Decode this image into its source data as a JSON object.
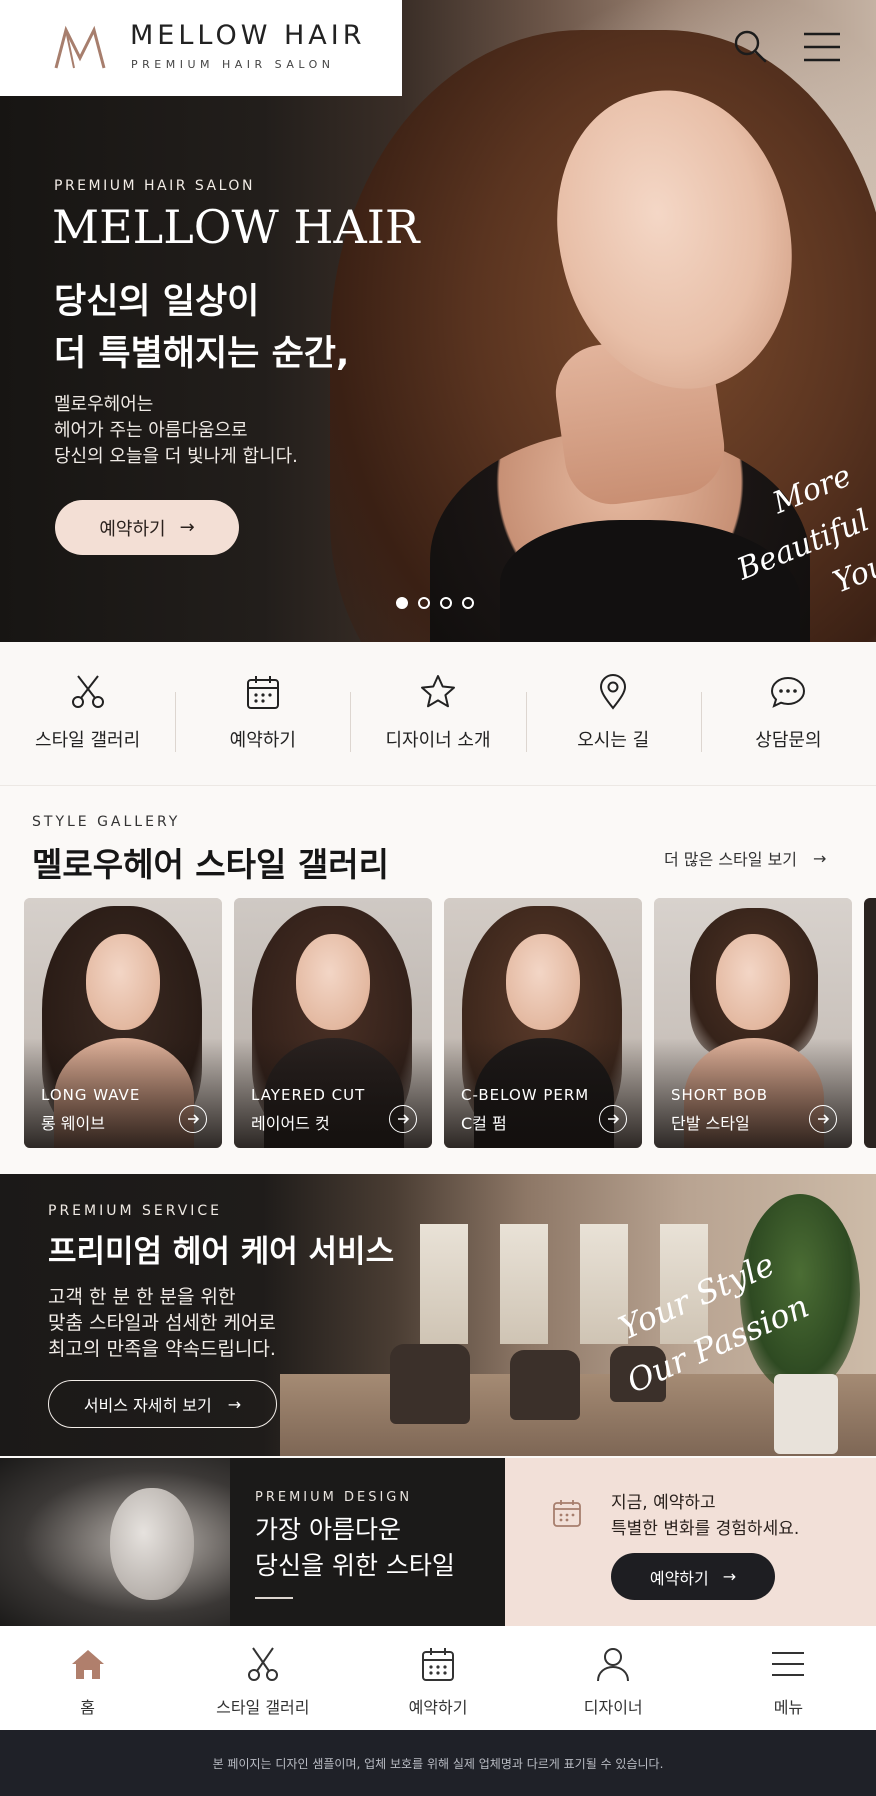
{
  "header": {
    "logo_title": "MELLOW HAIR",
    "logo_subtitle": "PREMIUM HAIR SALON",
    "logo_mark_icon": "mellow-hair-logo-icon",
    "search_icon": "search-icon",
    "menu_icon": "hamburger-menu-icon"
  },
  "hero": {
    "eyebrow": "PREMIUM HAIR SALON",
    "brand": "MELLOW HAIR",
    "headline": "당신의 일상이\n더 특별해지는 순간,",
    "description": "멜로우헤어는\n헤어가 주는 아름다움으로\n당신의 오늘을 더 빛나게 합니다.",
    "button_label": "예약하기",
    "button_arrow": "→",
    "script_text": "More Beautiful\nYou",
    "slides_total": 4,
    "active_slide": 1
  },
  "quick_menu": [
    {
      "label": "스타일 갤러리",
      "icon": "scissors-icon"
    },
    {
      "label": "예약하기",
      "icon": "calendar-icon"
    },
    {
      "label": "디자이너 소개",
      "icon": "star-icon"
    },
    {
      "label": "오시는 길",
      "icon": "map-pin-icon"
    },
    {
      "label": "상담문의",
      "icon": "chat-bubble-icon"
    }
  ],
  "gallery": {
    "eyebrow": "STYLE GALLERY",
    "title": "멜로우헤어 스타일 갤러리",
    "more_label": "더 많은 스타일 보기",
    "more_arrow": "→",
    "cards": [
      {
        "en": "LONG WAVE",
        "ko": "롱 웨이브"
      },
      {
        "en": "LAYERED CUT",
        "ko": "레이어드 컷"
      },
      {
        "en": "C-BELOW PERM",
        "ko": "C컬 펌"
      },
      {
        "en": "SHORT BOB",
        "ko": "단발 스타일"
      }
    ]
  },
  "service": {
    "eyebrow": "PREMIUM SERVICE",
    "title": "프리미엄 헤어 케어 서비스",
    "description": "고객 한 분 한 분을 위한\n맞춤 스타일과 섬세한 케어로\n최고의 만족을 약속드립니다.",
    "button_label": "서비스 자세히 보기",
    "button_arrow": "→",
    "script_text": "Your Style\nOur Passion"
  },
  "design": {
    "eyebrow": "PREMIUM DESIGN",
    "title": "가장 아름다운\n당신을 위한 스타일"
  },
  "reserve": {
    "icon": "calendar-icon",
    "text": "지금, 예약하고\n특별한 변화를 경험하세요.",
    "button_label": "예약하기",
    "button_arrow": "→"
  },
  "bottom_nav": [
    {
      "label": "홈",
      "icon": "home-icon",
      "active": true
    },
    {
      "label": "스타일 갤러리",
      "icon": "scissors-icon"
    },
    {
      "label": "예약하기",
      "icon": "calendar-icon"
    },
    {
      "label": "디자이너",
      "icon": "user-icon"
    },
    {
      "label": "메뉴",
      "icon": "hamburger-menu-icon"
    }
  ],
  "footer": {
    "notice": "본 페이지는 디자인 샘플이며, 업체 보호를 위해 실제 업체명과 다르게 표기될 수 있습니다."
  },
  "colors": {
    "accent_pink": "#f3dfd5",
    "accent_brown": "#a77e6d",
    "dark": "#1b1a19",
    "footer_bg": "#1f2128"
  }
}
